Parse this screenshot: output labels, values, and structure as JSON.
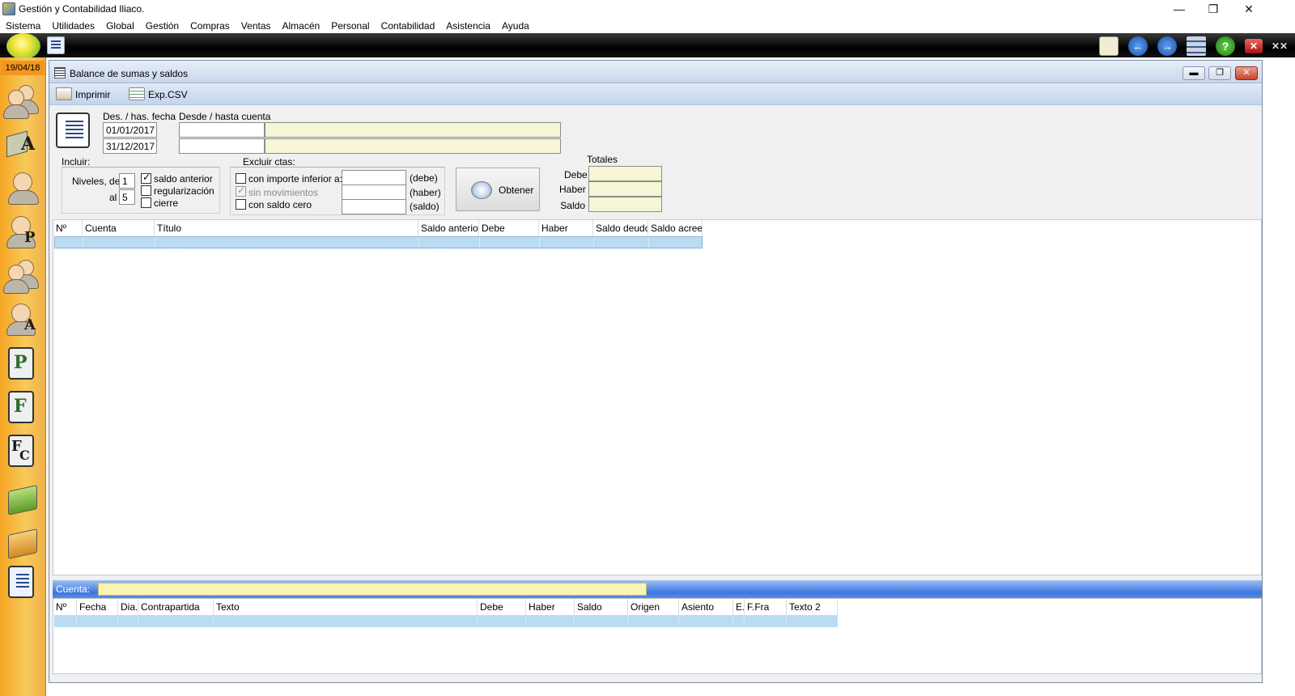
{
  "window": {
    "title": "Gestión y Contabilidad Iliaco.",
    "controls": {
      "minimize": "—",
      "restore": "❐",
      "close": "✕"
    }
  },
  "menu": [
    "Sistema",
    "Utilidades",
    "Global",
    "Gestión",
    "Compras",
    "Ventas",
    "Almacén",
    "Personal",
    "Contabilidad",
    "Asistencia",
    "Ayuda"
  ],
  "toolbar_icons": [
    "mail-icon",
    "back-icon",
    "forward-icon",
    "window-list-icon",
    "help-icon",
    "close-window-icon",
    "close-all-icon"
  ],
  "sidebar": {
    "date": "19/04/18",
    "items": [
      "users-group-icon",
      "articles-icon",
      "client-icon",
      "provider-icon",
      "contacts-icon",
      "agent-icon",
      "p-document-icon",
      "f-document-icon",
      "fc-document-icon",
      "green-bag-icon",
      "orange-bag-icon",
      "accounting-book-icon"
    ]
  },
  "child": {
    "title": "Balance de sumas y saldos",
    "controls": {
      "minimize": "▬",
      "restore": "❐",
      "close": "✕"
    },
    "commands": {
      "print": "Imprimir",
      "csv": "Exp.CSV"
    }
  },
  "filters": {
    "date_label": "Des. / has. fecha",
    "date_from": "01/01/2017",
    "date_to": "31/12/2017",
    "account_label": "Desde / hasta cuenta",
    "account_from": "",
    "account_from_name": "",
    "account_to": "",
    "account_to_name": "",
    "include_label": "Incluir:",
    "levels_from_label": "Niveles, del",
    "levels_from": "1",
    "levels_to_label": "al",
    "levels_to": "5",
    "include_options": [
      {
        "label": "saldo anterior",
        "checked": true,
        "disabled": false
      },
      {
        "label": "regularización",
        "checked": false,
        "disabled": false
      },
      {
        "label": "cierre",
        "checked": false,
        "disabled": false
      }
    ],
    "exclude_label": "Excluir ctas:",
    "exclude_options": [
      {
        "label": "con importe inferior a:",
        "checked": false,
        "disabled": false
      },
      {
        "label": "sin movimientos",
        "checked": true,
        "disabled": true
      },
      {
        "label": "con saldo cero",
        "checked": false,
        "disabled": false
      }
    ],
    "threshold_labels": [
      "(debe)",
      "(haber)",
      "(saldo)"
    ],
    "thresholds": [
      "",
      "",
      ""
    ],
    "obtain_button": "Obtener"
  },
  "totals": {
    "title": "Totales",
    "labels": [
      "Debe",
      "Haber",
      "Saldo"
    ],
    "values": [
      "",
      "",
      ""
    ]
  },
  "balance_grid": {
    "columns": [
      "Nº",
      "Cuenta",
      "Título",
      "Saldo anterior",
      "Debe",
      "Haber",
      "Saldo deudor",
      "Saldo acreedor"
    ],
    "rows": []
  },
  "account_bar": {
    "label": "Cuenta:",
    "value": ""
  },
  "movements_grid": {
    "columns": [
      "Nº",
      "Fecha",
      "Dia.",
      "Contrapartida",
      "Texto",
      "Debe",
      "Haber",
      "Saldo",
      "Origen",
      "Asiento",
      "E.",
      "F.Fra",
      "Texto 2"
    ],
    "rows": []
  },
  "colors": {
    "sidebar": "#f5a623",
    "title_bar_blue": "#3c76e0",
    "selection": "#b9dcf4",
    "field_yellow": "#f6f6d6"
  }
}
